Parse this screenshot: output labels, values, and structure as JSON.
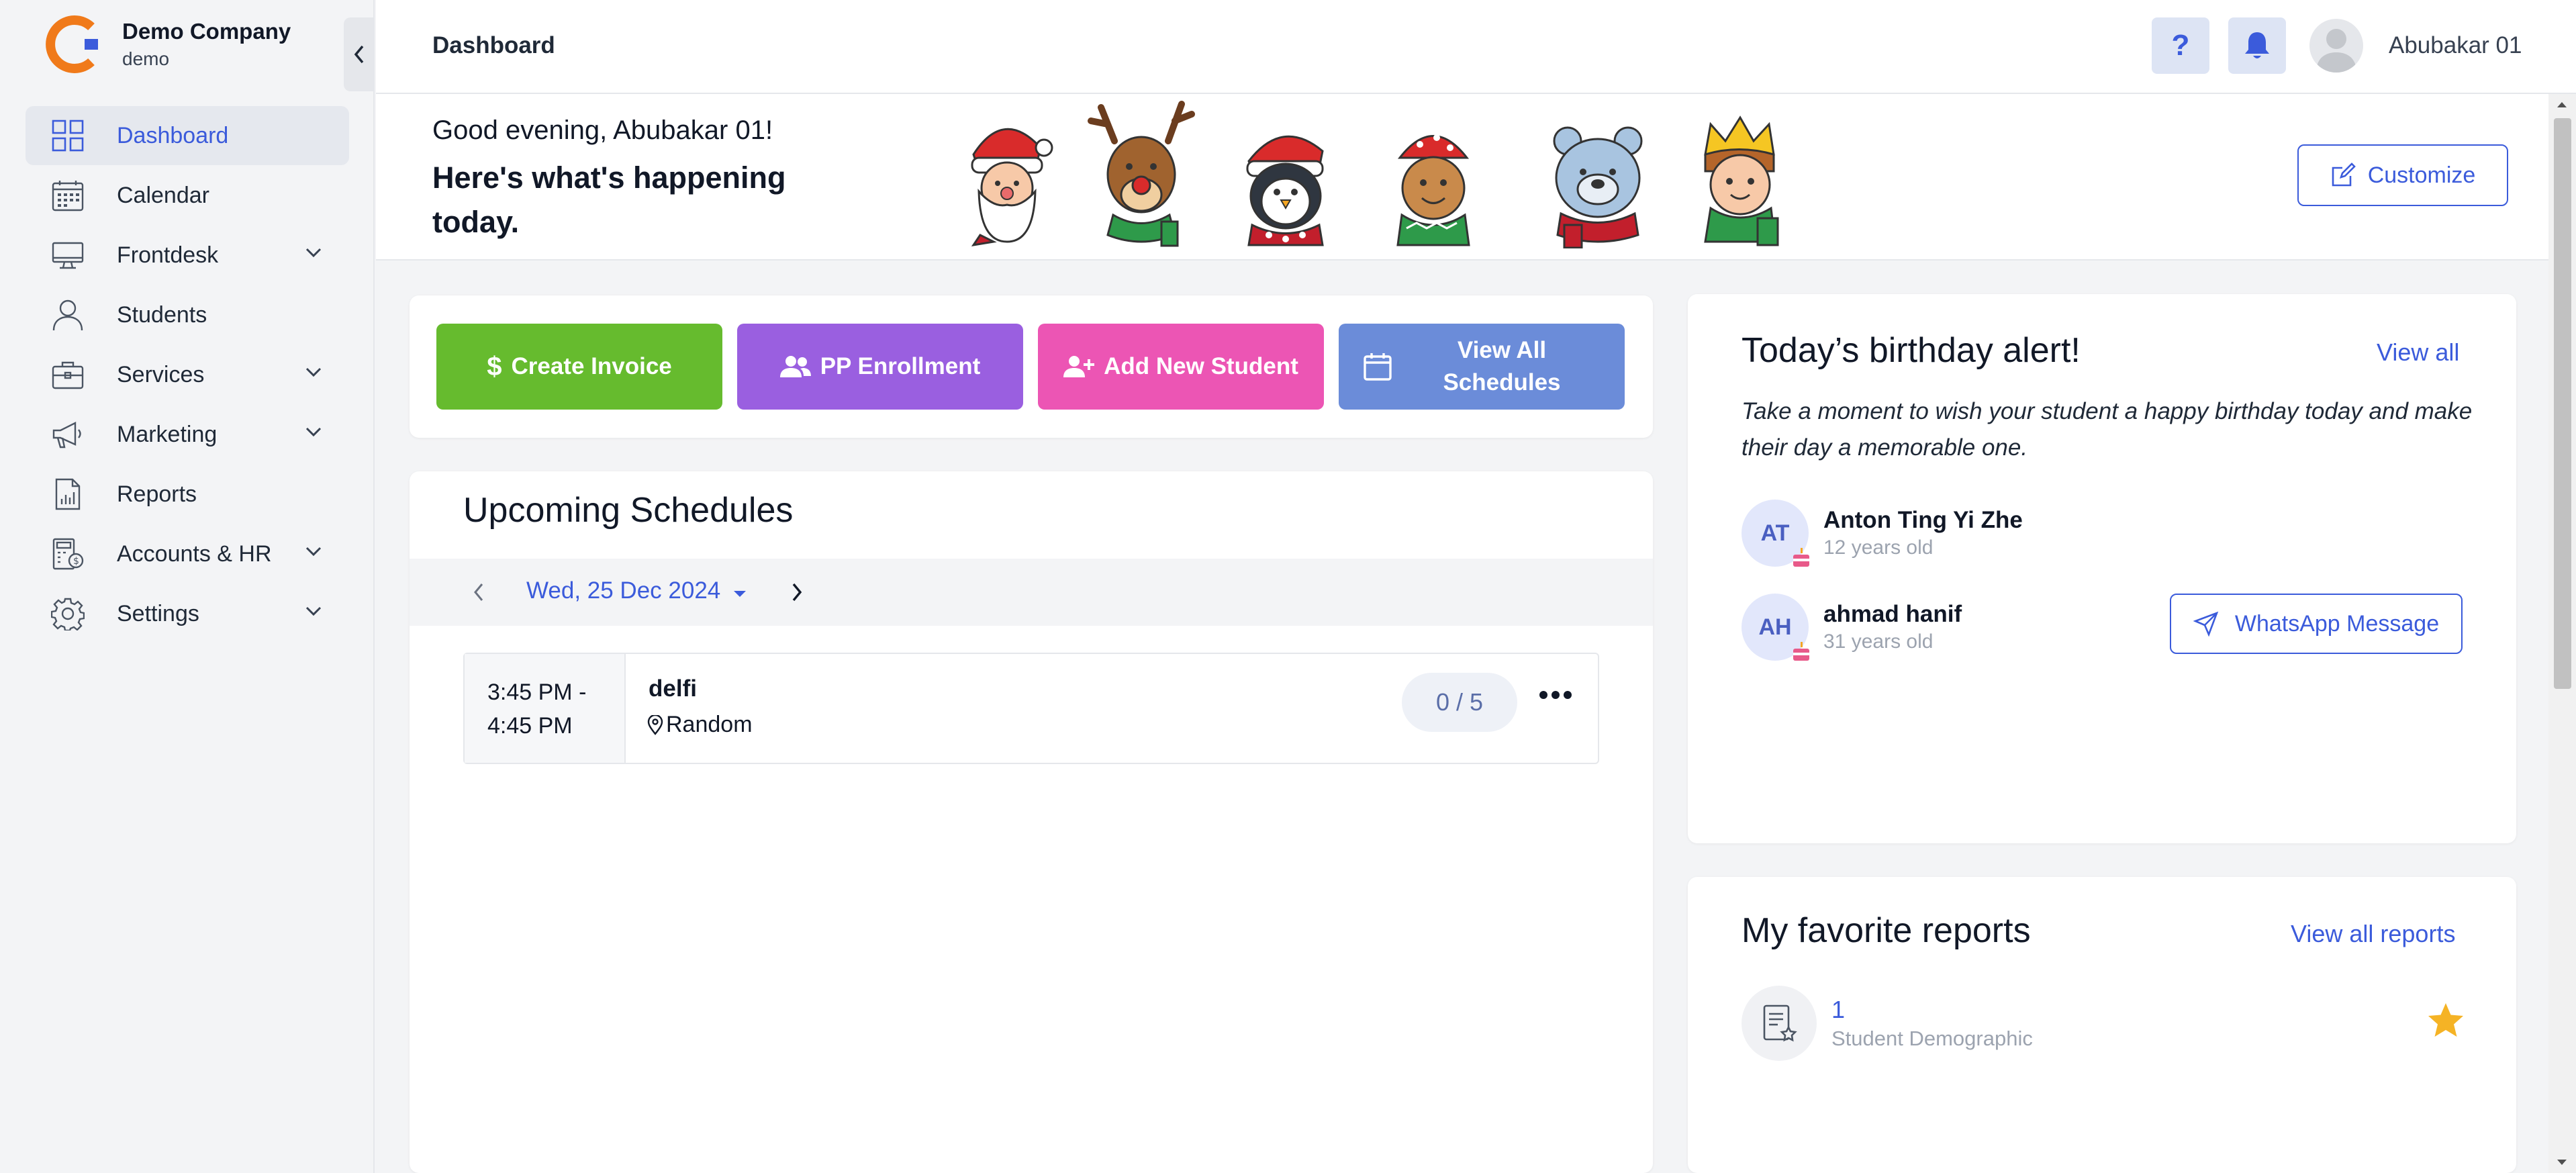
{
  "brand": {
    "name": "Demo Company",
    "sub": "demo"
  },
  "sidebar": {
    "items": [
      {
        "label": "Dashboard",
        "icon": "dashboard-grid-icon",
        "active": true,
        "has_submenu": false
      },
      {
        "label": "Calendar",
        "icon": "calendar-icon",
        "active": false,
        "has_submenu": false
      },
      {
        "label": "Frontdesk",
        "icon": "monitor-icon",
        "active": false,
        "has_submenu": true
      },
      {
        "label": "Students",
        "icon": "user-icon",
        "active": false,
        "has_submenu": false
      },
      {
        "label": "Services",
        "icon": "briefcase-icon",
        "active": false,
        "has_submenu": true
      },
      {
        "label": "Marketing",
        "icon": "megaphone-icon",
        "active": false,
        "has_submenu": true
      },
      {
        "label": "Reports",
        "icon": "report-chart-icon",
        "active": false,
        "has_submenu": false
      },
      {
        "label": "Accounts & HR",
        "icon": "accounts-icon",
        "active": false,
        "has_submenu": true
      },
      {
        "label": "Settings",
        "icon": "gear-icon",
        "active": false,
        "has_submenu": true
      }
    ]
  },
  "header": {
    "title": "Dashboard",
    "help_label": "?",
    "user_name": "Abubakar 01"
  },
  "banner": {
    "greeting": "Good evening, Abubakar 01!",
    "headline": "Here's what's happening today.",
    "customize_label": "Customize"
  },
  "actions": [
    {
      "label": "Create Invoice",
      "icon": "dollar-icon",
      "color": "#66bb2e"
    },
    {
      "label": "PP Enrollment",
      "icon": "users-icon",
      "color": "#9a5fe0"
    },
    {
      "label": "Add New Student",
      "icon": "user-plus-icon",
      "color": "#ec55b4"
    },
    {
      "label": "View All Schedules",
      "icon": "calendar-icon",
      "color": "#6b8cd9"
    }
  ],
  "schedules": {
    "title": "Upcoming Schedules",
    "date": "Wed, 25 Dec 2024",
    "items": [
      {
        "time_start": "3:45 PM -",
        "time_end": "4:45 PM",
        "name": "delfi",
        "location": "Random",
        "count": "0 / 5"
      }
    ]
  },
  "birthday": {
    "title": "Today’s birthday alert!",
    "view_all": "View all",
    "message": "Take a moment to wish your student a happy birthday today and make their day a memorable one.",
    "people": [
      {
        "initials": "AT",
        "name": "Anton Ting Yi Zhe",
        "age": "12 years old"
      },
      {
        "initials": "AH",
        "name": "ahmad hanif",
        "age": "31 years old"
      }
    ],
    "whatsapp_label": "WhatsApp Message"
  },
  "reports": {
    "title": "My favorite reports",
    "view_all": "View all reports",
    "items": [
      {
        "number": "1",
        "name": "Student Demographic",
        "favorited": true
      }
    ]
  },
  "colors": {
    "accent": "#3b5bdb",
    "brand_orange": "#f07a1a",
    "star": "#f5b325"
  }
}
